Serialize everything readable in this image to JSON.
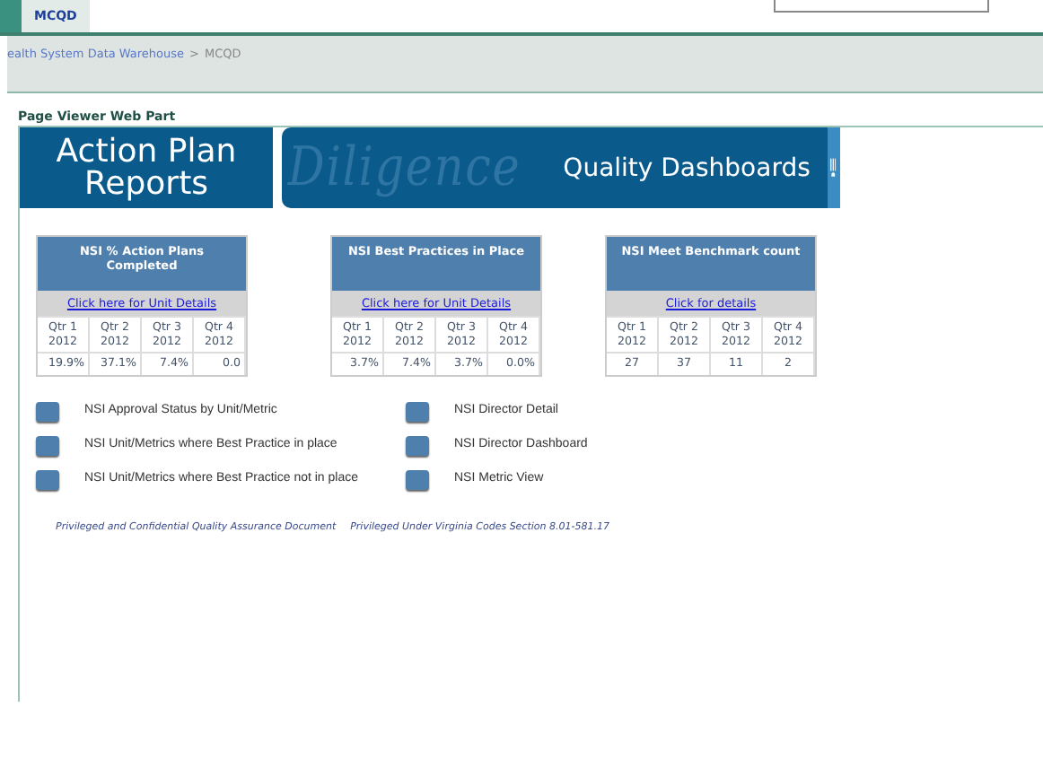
{
  "top_tabs": [
    {
      "label": "MCQD",
      "selected": true
    }
  ],
  "breadcrumb": {
    "parent": "ealth System Data Warehouse",
    "separator": ">",
    "current": "MCQD"
  },
  "web_part_title": "Page Viewer Web Part",
  "banner": {
    "left_title": "Action Plan Reports",
    "script_word": "Diligence",
    "right_title": "Quality Dashboards"
  },
  "cards": [
    {
      "title": "NSI % Action Plans Completed",
      "link": "Click here for Unit Details",
      "quarters": [
        "Qtr 1 2012",
        "Qtr 2 2012",
        "Qtr 3 2012",
        "Qtr 4 2012"
      ],
      "values": [
        "19.9%",
        "37.1%",
        "7.4%",
        "0.0"
      ]
    },
    {
      "title": "NSI Best Practices in Place",
      "link": "Click here for Unit Details",
      "quarters": [
        "Qtr 1 2012",
        "Qtr 2 2012",
        "Qtr 3 2012",
        "Qtr 4 2012"
      ],
      "values": [
        "3.7%",
        "7.4%",
        "3.7%",
        "0.0%"
      ]
    },
    {
      "title": "NSI Meet Benchmark count",
      "link": "Click for details",
      "quarters": [
        "Qtr 1 2012",
        "Qtr 2 2012",
        "Qtr 3 2012",
        "Qtr 4 2012"
      ],
      "values": [
        "27",
        "37",
        "11",
        "2"
      ]
    }
  ],
  "report_links": [
    {
      "label": "NSI Approval Status by Unit/Metric"
    },
    {
      "label": "NSI Director Detail"
    },
    {
      "label": "NSI Unit/Metrics where Best Practice in place"
    },
    {
      "label": "NSI Director Dashboard"
    },
    {
      "label": "NSI Unit/Metrics where Best Practice not in place"
    },
    {
      "label": "NSI Metric View"
    }
  ],
  "footer": [
    "Privileged and Confidential Quality Assurance Document",
    "Privileged Under Virginia Codes Section 8.01-581.17"
  ]
}
